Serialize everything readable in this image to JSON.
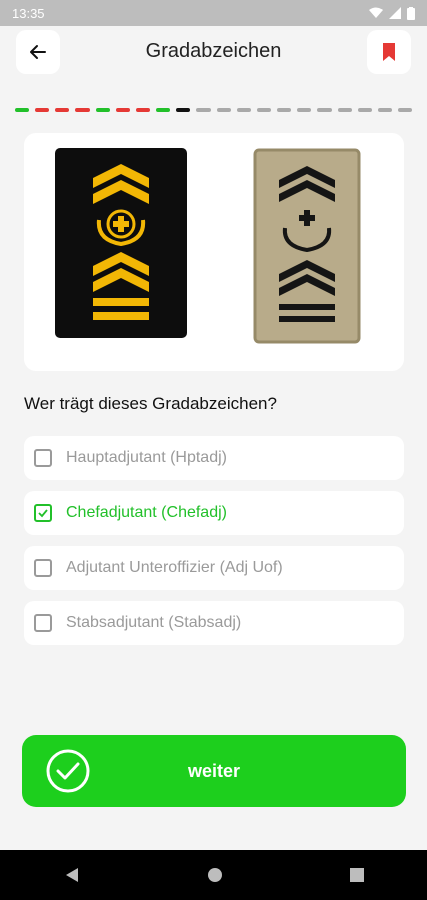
{
  "status_bar": {
    "time": "13:35"
  },
  "header": {
    "title": "Gradabzeichen",
    "back_icon": "arrow-left-icon",
    "bookmark_icon": "bookmark-icon",
    "bookmark_color": "#e53935"
  },
  "progress": {
    "segments": [
      "correct",
      "wrong",
      "wrong",
      "wrong",
      "correct",
      "wrong",
      "wrong",
      "correct",
      "current",
      "pending",
      "pending",
      "pending",
      "pending",
      "pending",
      "pending",
      "pending",
      "pending",
      "pending",
      "pending",
      "pending"
    ],
    "colors": {
      "correct": "#22c02a",
      "wrong": "#e53935",
      "current": "#111111",
      "pending": "#a9a9a9"
    }
  },
  "question": {
    "text": "Wer trägt dieses Gradabzeichen?"
  },
  "options": [
    {
      "label": "Hauptadjutant (Hptadj)",
      "checked": false
    },
    {
      "label": "Chefadjutant (Chefadj)",
      "checked": true
    },
    {
      "label": "Adjutant Unteroffizier (Adj Uof)",
      "checked": false
    },
    {
      "label": "Stabsadjutant (Stabsadj)",
      "checked": false
    }
  ],
  "next_button": {
    "label": "weiter",
    "icon": "check-circle-icon",
    "color": "#1dcf1d"
  },
  "accent_color": "#22c02a"
}
